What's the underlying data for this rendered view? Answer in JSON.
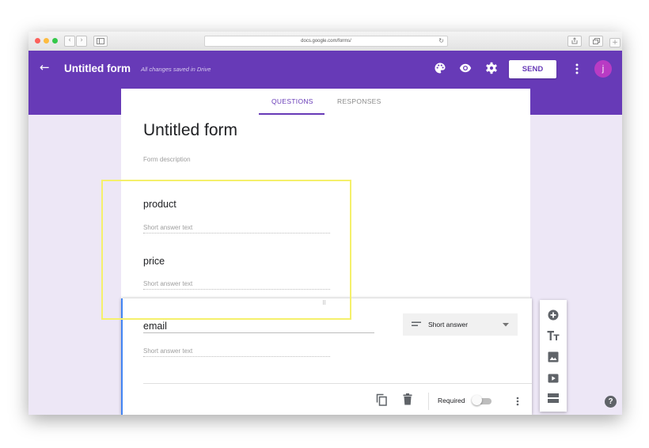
{
  "browser": {
    "url": "docs.google.com/forms/",
    "traffic_light_colors": [
      "#fc605b",
      "#fdbc40",
      "#34c84a"
    ]
  },
  "header": {
    "title": "Untitled form",
    "save_status": "All changes saved in Drive",
    "send_label": "SEND",
    "avatar_letter": "j",
    "brand_color": "#673ab7"
  },
  "tabs": [
    {
      "label": "QUESTIONS",
      "active": true
    },
    {
      "label": "RESPONSES",
      "active": false
    }
  ],
  "form": {
    "title": "Untitled form",
    "description_placeholder": "Form description"
  },
  "questions": [
    {
      "title": "product",
      "answer_placeholder": "Short answer text"
    },
    {
      "title": "price",
      "answer_placeholder": "Short answer text"
    },
    {
      "title": "email",
      "answer_placeholder": "Short answer text",
      "type": "Short answer",
      "required_label": "Required",
      "required": false
    }
  ],
  "toolbar_icons": [
    "add-question-icon",
    "add-title-icon",
    "add-image-icon",
    "add-video-icon",
    "add-section-icon"
  ],
  "highlight_color": "#f5f06b"
}
